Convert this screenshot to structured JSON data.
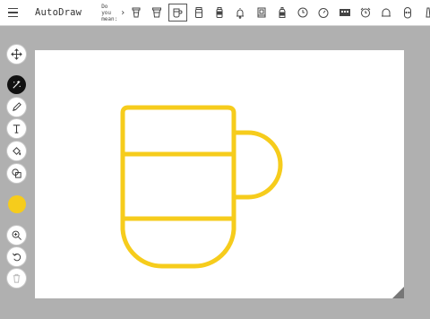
{
  "app": {
    "title": "AutoDraw"
  },
  "header": {
    "did_you_mean_label": "Do you mean:",
    "arrow_glyph": "›",
    "suggestions": [
      {
        "name": "cup-lid-icon"
      },
      {
        "name": "cup-icon"
      },
      {
        "name": "mug-icon",
        "selected": true
      },
      {
        "name": "coffee-cup-icon"
      },
      {
        "name": "jar-icon"
      },
      {
        "name": "bell-icon"
      },
      {
        "name": "frame-icon"
      },
      {
        "name": "bottle-icon"
      },
      {
        "name": "clock-icon"
      },
      {
        "name": "stopwatch-icon"
      },
      {
        "name": "calendar-icon"
      },
      {
        "name": "alarm-clock-icon"
      },
      {
        "name": "teapot-icon"
      },
      {
        "name": "face-icon"
      },
      {
        "name": "more-icon"
      }
    ]
  },
  "toolbar": {
    "tools": [
      {
        "name": "move-tool-icon"
      },
      {
        "name": "autodraw-tool-icon",
        "active": true
      },
      {
        "name": "draw-tool-icon"
      },
      {
        "name": "type-tool-icon"
      },
      {
        "name": "fill-tool-icon"
      },
      {
        "name": "shape-tool-icon"
      }
    ],
    "current_color": "#f6cc1c",
    "zoom_icon": "zoom-icon",
    "undo_icon": "undo-icon",
    "delete_icon": "trash-icon"
  },
  "canvas": {
    "stroke_color": "#f6cc1c",
    "drawing": "mug"
  }
}
